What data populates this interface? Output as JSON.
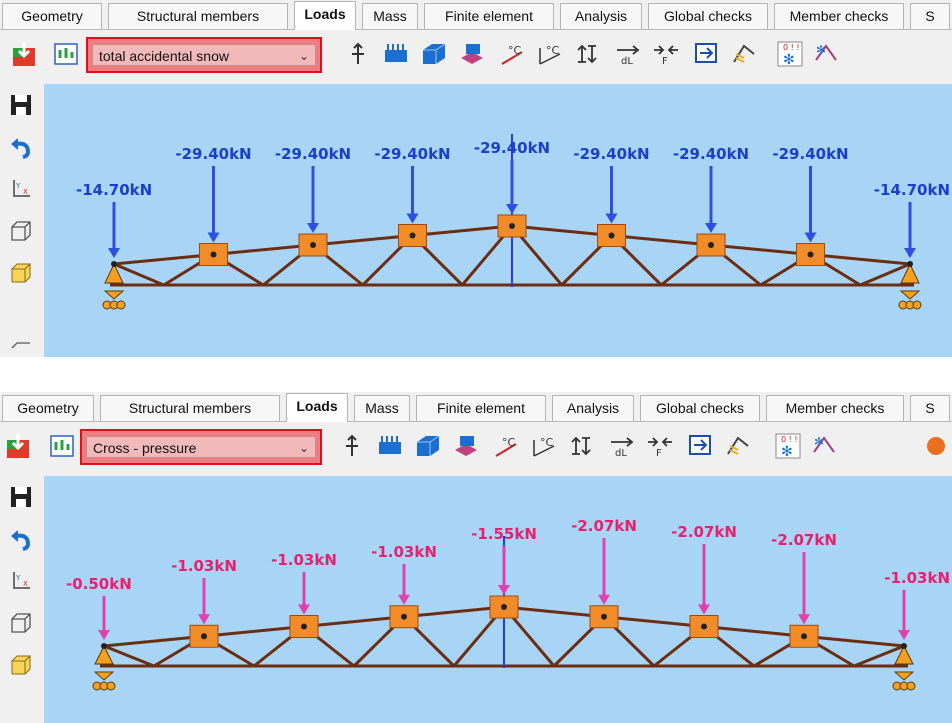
{
  "tabs": [
    "Geometry",
    "Structural members",
    "Loads",
    "Mass",
    "Finite element",
    "Analysis",
    "Global checks",
    "Member checks",
    "S"
  ],
  "active_tab": "Loads",
  "panels": [
    {
      "load_case": "total accidental snow",
      "load_color": "#2f4fe0",
      "loads": [
        "-14.70kN",
        "-29.40kN",
        "-29.40kN",
        "-29.40kN",
        "-29.40kN",
        "-29.40kN",
        "-29.40kN",
        "-29.40kN",
        "-14.70kN"
      ]
    },
    {
      "load_case": "Cross - pressure",
      "load_color": "#e040b0",
      "loads": [
        "-0.50kN",
        "-1.03kN",
        "-1.03kN",
        "-1.03kN",
        "-1.55kN",
        "-2.07kN",
        "-2.07kN",
        "-2.07kN",
        "-1.03kN"
      ]
    }
  ],
  "colors": {
    "canvas_bg": "#a8d4f5",
    "member": "#6b2e12",
    "node_box": "#f28c28",
    "support": "#f5a020",
    "blue_label": "#1a3fc8",
    "pink_label": "#e8206e"
  },
  "icons": {
    "toolbar": [
      "import-icon",
      "table-icon",
      "dropdown",
      "node-load-icon",
      "line-load-icon",
      "surface-load-icon",
      "member-load-icon",
      "temperature-icon",
      "temperature-gradient-icon",
      "eccentricity-icon",
      "elongation-icon",
      "prestress-icon",
      "load-panel-icon",
      "wind-load-icon",
      "snow-load-icon",
      "wind-snow-icon"
    ],
    "sidebar": [
      "save-icon",
      "undo-icon",
      "axes-icon",
      "wireframe-view-icon",
      "solid-view-icon"
    ]
  }
}
